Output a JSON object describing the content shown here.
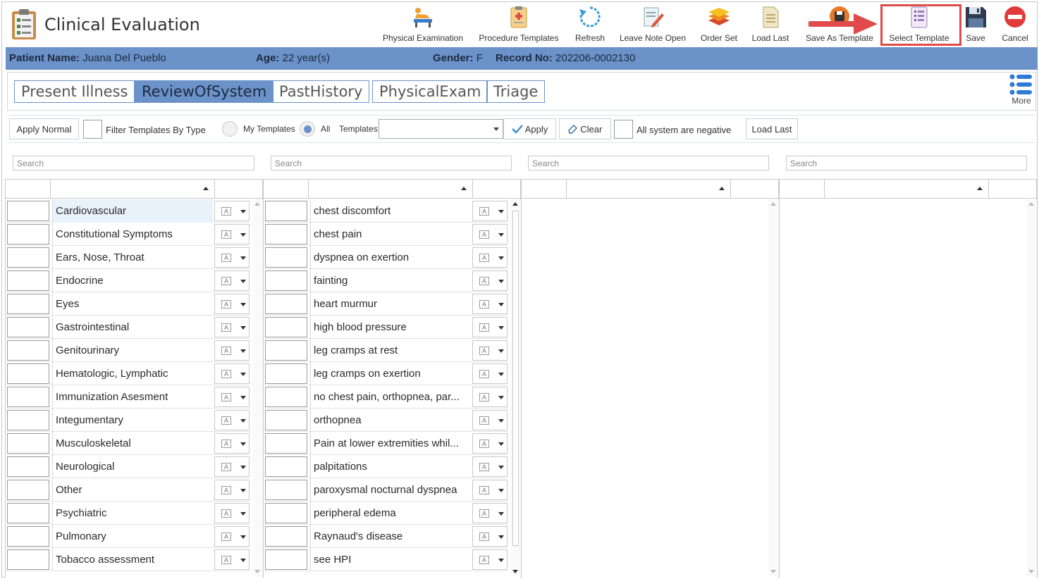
{
  "header": {
    "title": "Clinical Evaluation",
    "toolbar": [
      {
        "id": "physical-examination",
        "label": "Physical Examination"
      },
      {
        "id": "procedure-templates",
        "label": "Procedure Templates"
      },
      {
        "id": "refresh",
        "label": "Refresh"
      },
      {
        "id": "leave-note-open",
        "label": "Leave Note Open"
      },
      {
        "id": "order-set",
        "label": "Order Set"
      },
      {
        "id": "load-last",
        "label": "Load Last"
      },
      {
        "id": "save-as-template",
        "label": "Save As Template"
      },
      {
        "id": "select-template",
        "label": "Select Template"
      },
      {
        "id": "save",
        "label": "Save"
      },
      {
        "id": "cancel",
        "label": "Cancel"
      }
    ]
  },
  "patient": {
    "name_label": "Patient Name:",
    "name": "Juana Del Pueblo",
    "age_label": "Age:",
    "age": "22 year(s)",
    "gender_label": "Gender:",
    "gender": "F",
    "record_label": "Record No:",
    "record": "202206-0002130"
  },
  "tabs": [
    {
      "label": "Present Illness",
      "active": false
    },
    {
      "label": "ReviewOfSystem",
      "active": true
    },
    {
      "label": "PastHistory",
      "active": false
    },
    {
      "label": "PhysicalExam",
      "active": false
    },
    {
      "label": "Triage",
      "active": false
    }
  ],
  "more_label": "More",
  "filters": {
    "apply_normal": "Apply Normal",
    "filter_by_type": "Filter Templates By Type",
    "my_templates": "My Templates",
    "all": "All",
    "selected_scope": "All",
    "templates_label": "Templates:",
    "templates_value": "",
    "apply": "Apply",
    "clear": "Clear",
    "all_negative": "All system are negative",
    "load_last": "Load Last"
  },
  "search": {
    "placeholder": "Search"
  },
  "systems": [
    "Cardiovascular",
    "Constitutional Symptoms",
    "Ears, Nose, Throat",
    "Endocrine",
    "Eyes",
    "Gastrointestinal",
    "Genitourinary",
    "Hematologic, Lymphatic",
    "Immunization Asesment",
    "Integumentary",
    "Musculoskeletal",
    "Neurological",
    "Other",
    "Psychiatric",
    "Pulmonary",
    "Tobacco assessment"
  ],
  "selected_system": "Cardiovascular",
  "symptoms": [
    "chest discomfort",
    "chest pain",
    "dyspnea on exertion",
    "fainting",
    "heart murmur",
    "high blood pressure",
    "leg cramps at rest",
    "leg cramps on exertion",
    "no chest pain, orthopnea, par...",
    "orthopnea",
    "Pain at lower extremities whil...",
    "palpitations",
    "paroxysmal nocturnal dyspnea",
    "peripheral edema",
    "Raynaud's disease",
    "see HPI"
  ],
  "colors": {
    "accent": "#6b92c9",
    "highlight": "#e04a4a"
  }
}
